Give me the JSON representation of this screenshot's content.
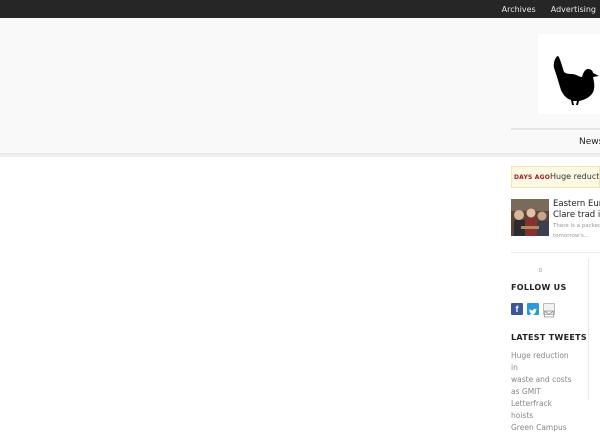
{
  "topbar": {
    "links": [
      "Archives",
      "Advertising"
    ]
  },
  "header": {
    "logo": "wren-logo"
  },
  "nav": {
    "items": [
      "News"
    ]
  },
  "ticker": {
    "date_label": "DAYS AGO",
    "headline": "Huge reduction"
  },
  "featured_post": {
    "title_lines": [
      "Eastern Euro",
      "Clare trad in"
    ],
    "excerpt_lines": [
      "There is a packed c",
      "tomorrow's..."
    ]
  },
  "follow": {
    "title": "FOLLOW US",
    "icons": [
      "facebook-icon",
      "twitter-icon",
      "email-icon"
    ],
    "icon_colors": {
      "facebook": "#3b5998",
      "twitter": "#2a9bd8",
      "email": "#f2f2f2"
    }
  },
  "tweets": {
    "title": "LATEST TWEETS",
    "text_lines": [
      "Huge reduction in",
      "waste and costs",
      "as GMIT",
      "Letterfrack hoists",
      "Green Campus"
    ]
  },
  "colors": {
    "topbar": "#262626",
    "header": "#f9f9f9",
    "ticker_bg": "#fcf8e3",
    "ticker_date": "#9a1b1b"
  }
}
